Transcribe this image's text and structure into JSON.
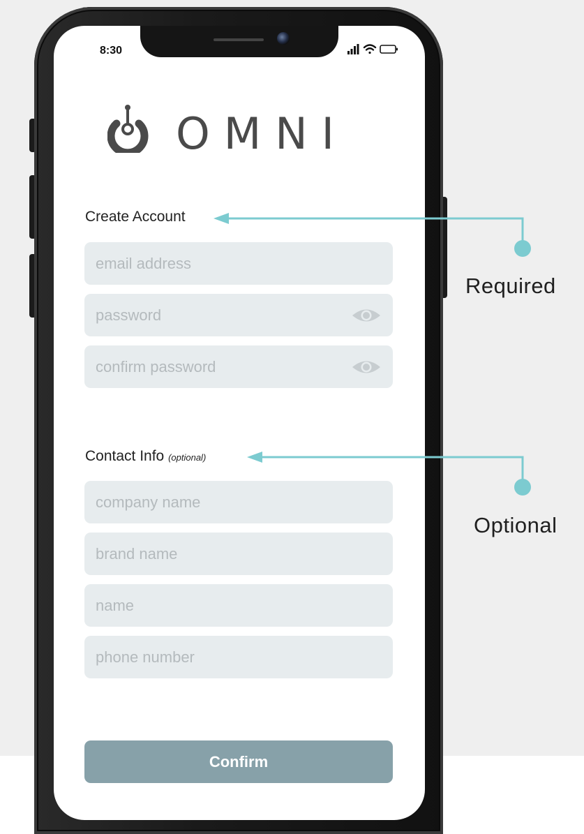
{
  "status_bar": {
    "time": "8:30"
  },
  "logo": {
    "text": "OMNI"
  },
  "create_account": {
    "title": "Create Account",
    "email_placeholder": "email address",
    "password_placeholder": "password",
    "confirm_password_placeholder": "confirm password"
  },
  "contact_info": {
    "title": "Contact Info",
    "optional_note": "(optional)",
    "company_placeholder": "company name",
    "brand_placeholder": "brand name",
    "name_placeholder": "name",
    "phone_placeholder": "phone number"
  },
  "confirm_button": {
    "label": "Confirm"
  },
  "annotations": {
    "required_label": "Required",
    "optional_label": "Optional"
  },
  "colors": {
    "accent_teal": "#7ccbd0",
    "field_bg": "#e7ecee",
    "button_bg": "#87a1a9",
    "logo_grey": "#4a4a4a"
  },
  "icons": {
    "visibility": "eye-icon",
    "signal": "signal-bars-icon",
    "wifi": "wifi-icon",
    "battery": "battery-icon",
    "logo_mark": "omni-power-logo-icon"
  }
}
